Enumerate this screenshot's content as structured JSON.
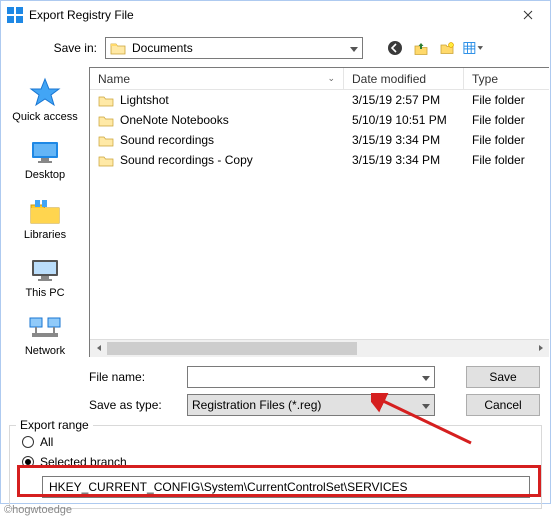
{
  "titlebar": {
    "title": "Export Registry File"
  },
  "savein": {
    "label": "Save in",
    "location": "Documents"
  },
  "columns": {
    "name": "Name",
    "date": "Date modified",
    "type": "Type"
  },
  "files": [
    {
      "name": "Lightshot",
      "date": "3/15/19 2:57 PM",
      "type": "File folder"
    },
    {
      "name": "OneNote Notebooks",
      "date": "5/10/19 10:51 PM",
      "type": "File folder"
    },
    {
      "name": "Sound recordings",
      "date": "3/15/19 3:34 PM",
      "type": "File folder"
    },
    {
      "name": "Sound recordings - Copy",
      "date": "3/15/19 3:34 PM",
      "type": "File folder"
    }
  ],
  "sidebar": {
    "items": [
      {
        "label": "Quick access"
      },
      {
        "label": "Desktop"
      },
      {
        "label": "Libraries"
      },
      {
        "label": "This PC"
      },
      {
        "label": "Network"
      }
    ]
  },
  "fields": {
    "filename_label": "File name",
    "filename_value": "",
    "saveastype_label": "Save as type",
    "saveastype_value": "Registration Files (*.reg)"
  },
  "buttons": {
    "save": "Save",
    "cancel": "Cancel"
  },
  "export_range": {
    "group_label": "Export range",
    "all": "All",
    "selected": "Selected branch",
    "branch_value": "HKEY_CURRENT_CONFIG\\System\\CurrentControlSet\\SERVICES"
  },
  "watermark": "©hogwtoedge"
}
